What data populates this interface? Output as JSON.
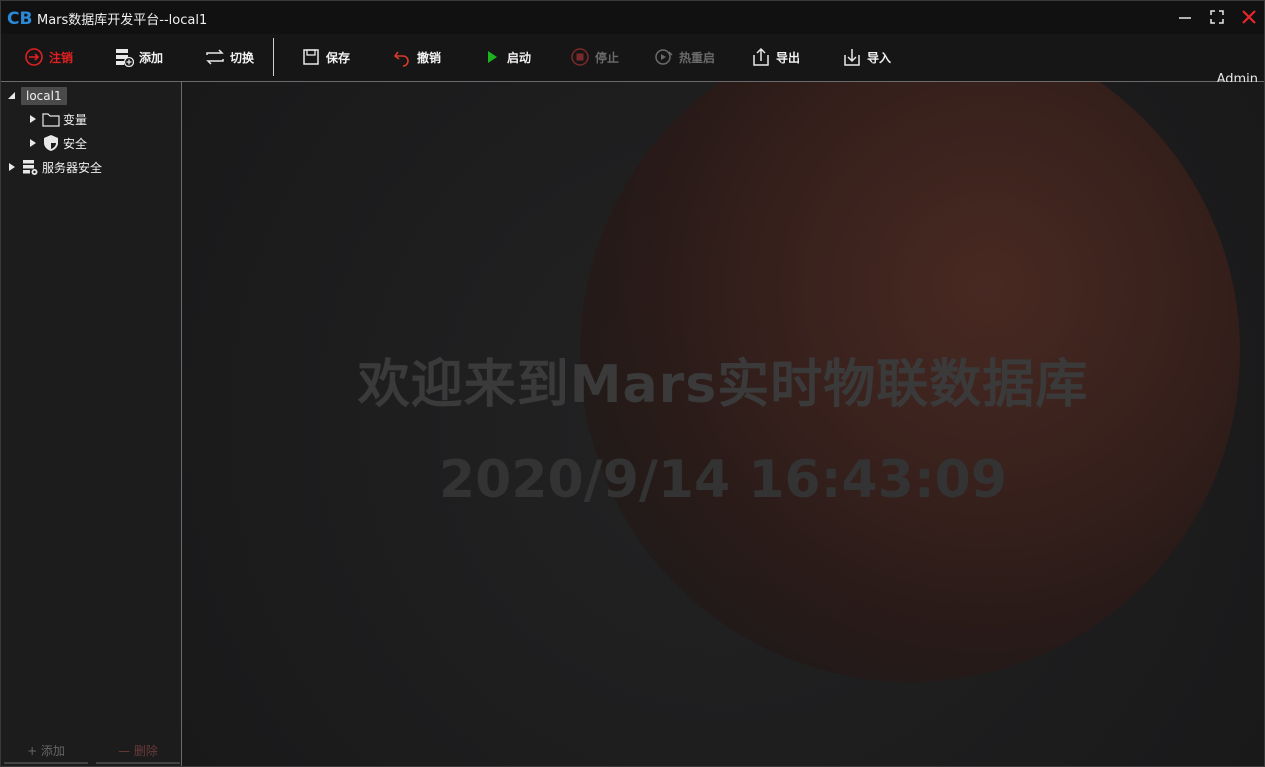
{
  "titlebar": {
    "title": "Mars数据库开发平台--local1",
    "logo_text": "CB."
  },
  "user": {
    "name": "Admin"
  },
  "toolbar": {
    "logout": "注销",
    "add": "添加",
    "switch": "切换",
    "save": "保存",
    "undo": "撤销",
    "start": "启动",
    "stop": "停止",
    "hot_restart": "热重启",
    "export": "导出",
    "import": "导入"
  },
  "tree": {
    "root": "local1",
    "children": [
      "变量",
      "安全"
    ],
    "server_security": "服务器安全"
  },
  "left_bottom": {
    "add": "+ 添加",
    "delete": "— 删除"
  },
  "main": {
    "welcome": "欢迎来到Mars实时物联数据库",
    "datetime": "2020/9/14 16:43:09"
  },
  "colors": {
    "accent_red": "#e02020",
    "start_green": "#1db31d",
    "disabled": "#6a6a6a"
  }
}
